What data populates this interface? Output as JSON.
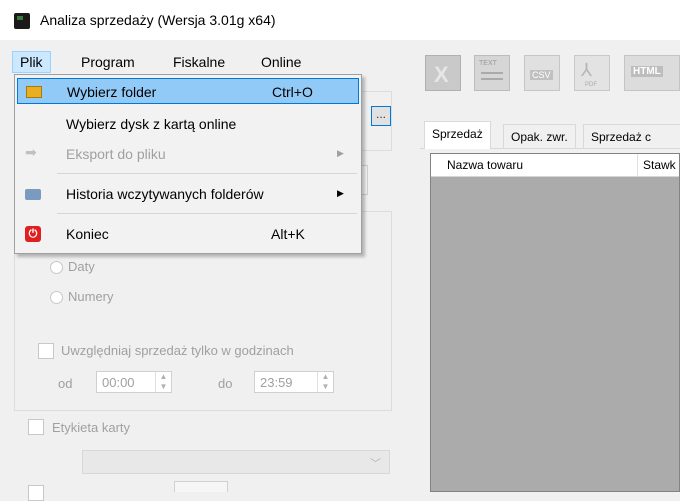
{
  "window": {
    "title": "Analiza sprzedaży (Wersja 3.01g x64)"
  },
  "menubar": {
    "items": [
      "Plik",
      "Program",
      "Fiskalne",
      "Online"
    ]
  },
  "file_menu": {
    "items": [
      {
        "label": "Wybierz folder",
        "shortcut": "Ctrl+O",
        "icon": "folder-icon"
      },
      {
        "label": "Wybierz dysk z kartą online",
        "shortcut": "",
        "icon": ""
      },
      {
        "label": "Eksport do pliku",
        "shortcut": "",
        "icon": "arrow-right-icon"
      },
      {
        "label": "Historia wczytywanych folderów",
        "shortcut": "",
        "icon": "history-icon"
      },
      {
        "label": "Koniec",
        "shortcut": "Alt+K",
        "icon": "power-icon"
      }
    ]
  },
  "left": {
    "browse_button": "...",
    "radio_dates": "Daty",
    "radio_numbers": "Numery",
    "hours_check": "Uwzględniaj sprzedaż tylko w godzinach",
    "from_label": "od",
    "from_value": "00:00",
    "to_label": "do",
    "to_value": "23:59",
    "card_label_check": "Etykieta karty"
  },
  "toolbar": {
    "icons": [
      "excel-icon",
      "text-file-icon",
      "csv-icon",
      "pdf-icon",
      "html-icon"
    ],
    "csv_text": "CSV",
    "pdf_text": "PDF",
    "html_text": "HTML",
    "txt_text": "TEXT"
  },
  "tabs": [
    "Sprzedaż",
    "Opak. zwr.",
    "Sprzedaż c"
  ],
  "grid": {
    "columns": [
      "Nazwa towaru",
      "Stawk"
    ]
  },
  "colors": {
    "highlight": "#91c9f7",
    "accent_border": "#0078d7",
    "grid_bg": "#ababab"
  }
}
